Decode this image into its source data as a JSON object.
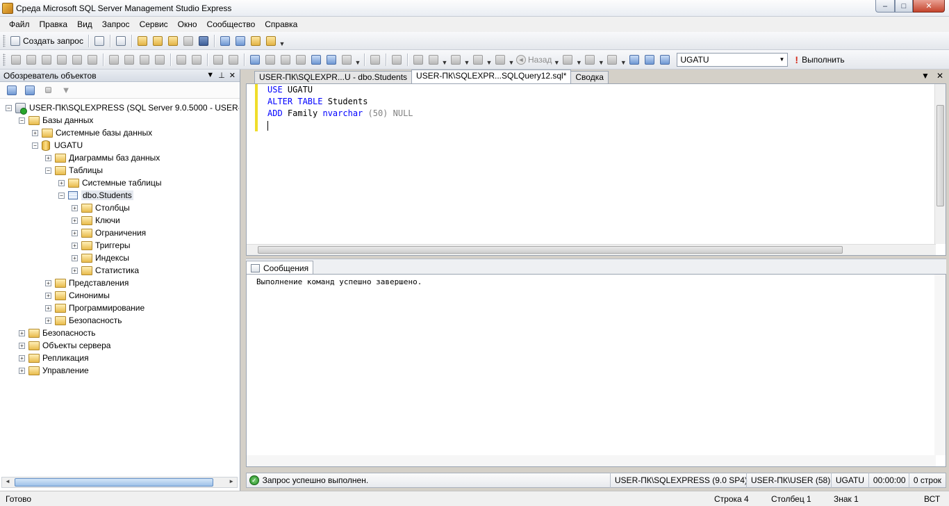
{
  "window": {
    "title": "Среда Microsoft SQL Server Management Studio Express",
    "min": "–",
    "max": "□",
    "close": "✕"
  },
  "menu": [
    "Файл",
    "Правка",
    "Вид",
    "Запрос",
    "Сервис",
    "Окно",
    "Сообщество",
    "Справка"
  ],
  "toolbar1": {
    "new_query": "Создать запрос"
  },
  "toolbar2": {
    "back": "Назад",
    "database": "UGATU",
    "execute": "Выполнить"
  },
  "object_explorer": {
    "title": "Обозреватель объектов",
    "tree": [
      {
        "label": "USER-ПК\\SQLEXPRESS (SQL Server 9.0.5000 - USER-ПК\\U",
        "expanded": "−"
      },
      {
        "label": "Базы данных",
        "expanded": "−"
      },
      {
        "label": "Системные базы данных",
        "expanded": "+"
      },
      {
        "label": "UGATU",
        "expanded": "−"
      },
      {
        "label": "Диаграммы баз данных",
        "expanded": "+"
      },
      {
        "label": "Таблицы",
        "expanded": "−"
      },
      {
        "label": "Системные таблицы",
        "expanded": "+"
      },
      {
        "label": "dbo.Students",
        "expanded": "−"
      },
      {
        "label": "Столбцы",
        "expanded": "+"
      },
      {
        "label": "Ключи",
        "expanded": "+"
      },
      {
        "label": "Ограничения",
        "expanded": "+"
      },
      {
        "label": "Триггеры",
        "expanded": "+"
      },
      {
        "label": "Индексы",
        "expanded": "+"
      },
      {
        "label": "Статистика",
        "expanded": "+"
      },
      {
        "label": "Представления",
        "expanded": "+"
      },
      {
        "label": "Синонимы",
        "expanded": "+"
      },
      {
        "label": "Программирование",
        "expanded": "+"
      },
      {
        "label": "Безопасность",
        "expanded": "+"
      },
      {
        "label": "Безопасность",
        "expanded": "+"
      },
      {
        "label": "Объекты сервера",
        "expanded": "+"
      },
      {
        "label": "Репликация",
        "expanded": "+"
      },
      {
        "label": "Управление",
        "expanded": "+"
      }
    ]
  },
  "tabs": [
    {
      "label": "USER-ПК\\SQLEXPR...U - dbo.Students",
      "active": false
    },
    {
      "label": "USER-ПК\\SQLEXPR...SQLQuery12.sql*",
      "active": true
    },
    {
      "label": "Сводка",
      "active": false
    }
  ],
  "editor": {
    "line1_kw": "USE",
    "line1_rest": " UGATU",
    "line2_kw": "ALTER TABLE",
    "line2_rest": " Students",
    "line3_kw": "ADD",
    "line3_mid": " Family ",
    "line3_type": "nvarchar",
    "line3_rest": " (50) NULL"
  },
  "results": {
    "tab_label": "Сообщения",
    "message": "Выполнение команд успешно завершено."
  },
  "query_status": {
    "message": "Запрос успешно выполнен.",
    "server": "USER-ПК\\SQLEXPRESS (9.0 SP4)",
    "user": "USER-ПК\\USER (58)",
    "database": "UGATU",
    "elapsed": "00:00:00",
    "rows": "0 строк"
  },
  "statusbar": {
    "ready": "Готово",
    "line": "Строка 4",
    "column": "Столбец 1",
    "char": "Знак 1",
    "mode": "ВСТ"
  },
  "colors": {
    "keyword": "#0000ff",
    "gray": "#808080",
    "gutter": "#f0dd2b"
  }
}
